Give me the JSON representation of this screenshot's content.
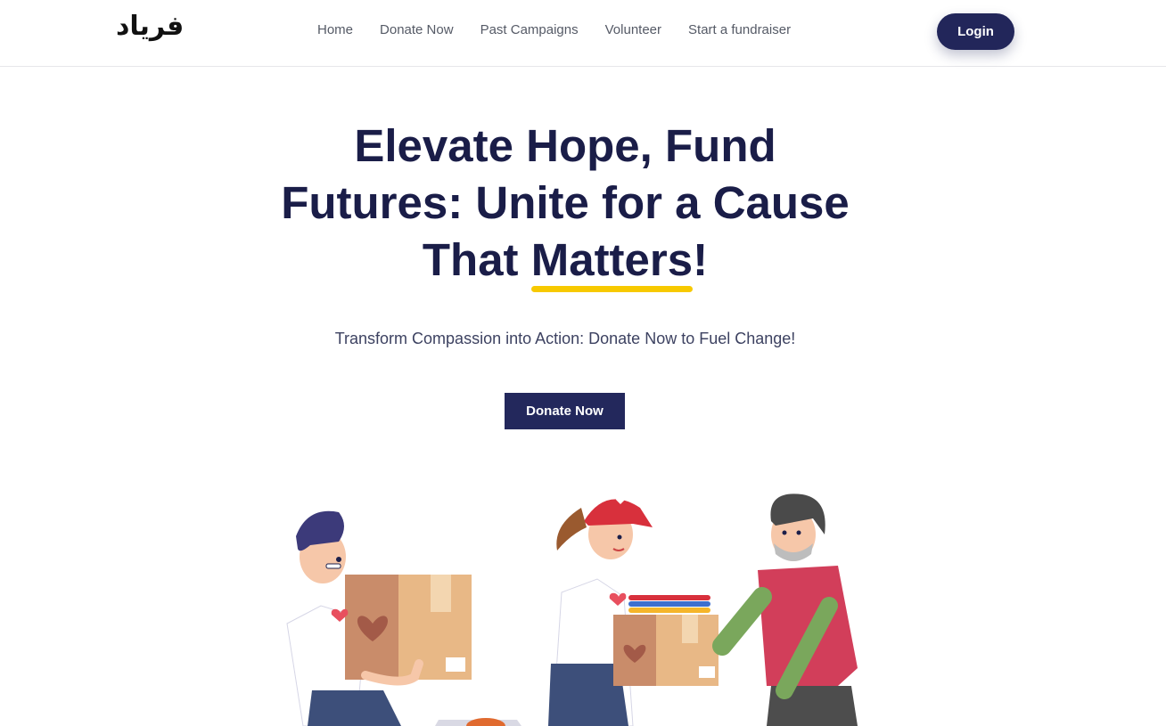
{
  "header": {
    "logo_text": "فریاد",
    "nav": [
      "Home",
      "Donate Now",
      "Past Campaigns",
      "Volunteer",
      "Start a fundraiser"
    ],
    "login_label": "Login"
  },
  "hero": {
    "title_before": "Elevate Hope, Fund Futures: Unite for a Cause That ",
    "title_highlight": "Matters",
    "title_after": "!",
    "subtitle": "Transform Compassion into Action: Donate Now to Fuel Change!",
    "cta_label": "Donate Now"
  },
  "colors": {
    "primary": "#23285c",
    "accent_underline": "#f7c900",
    "heading": "#1a1d48"
  },
  "illustration": {
    "description_icon": "volunteers-donation-illustration"
  }
}
